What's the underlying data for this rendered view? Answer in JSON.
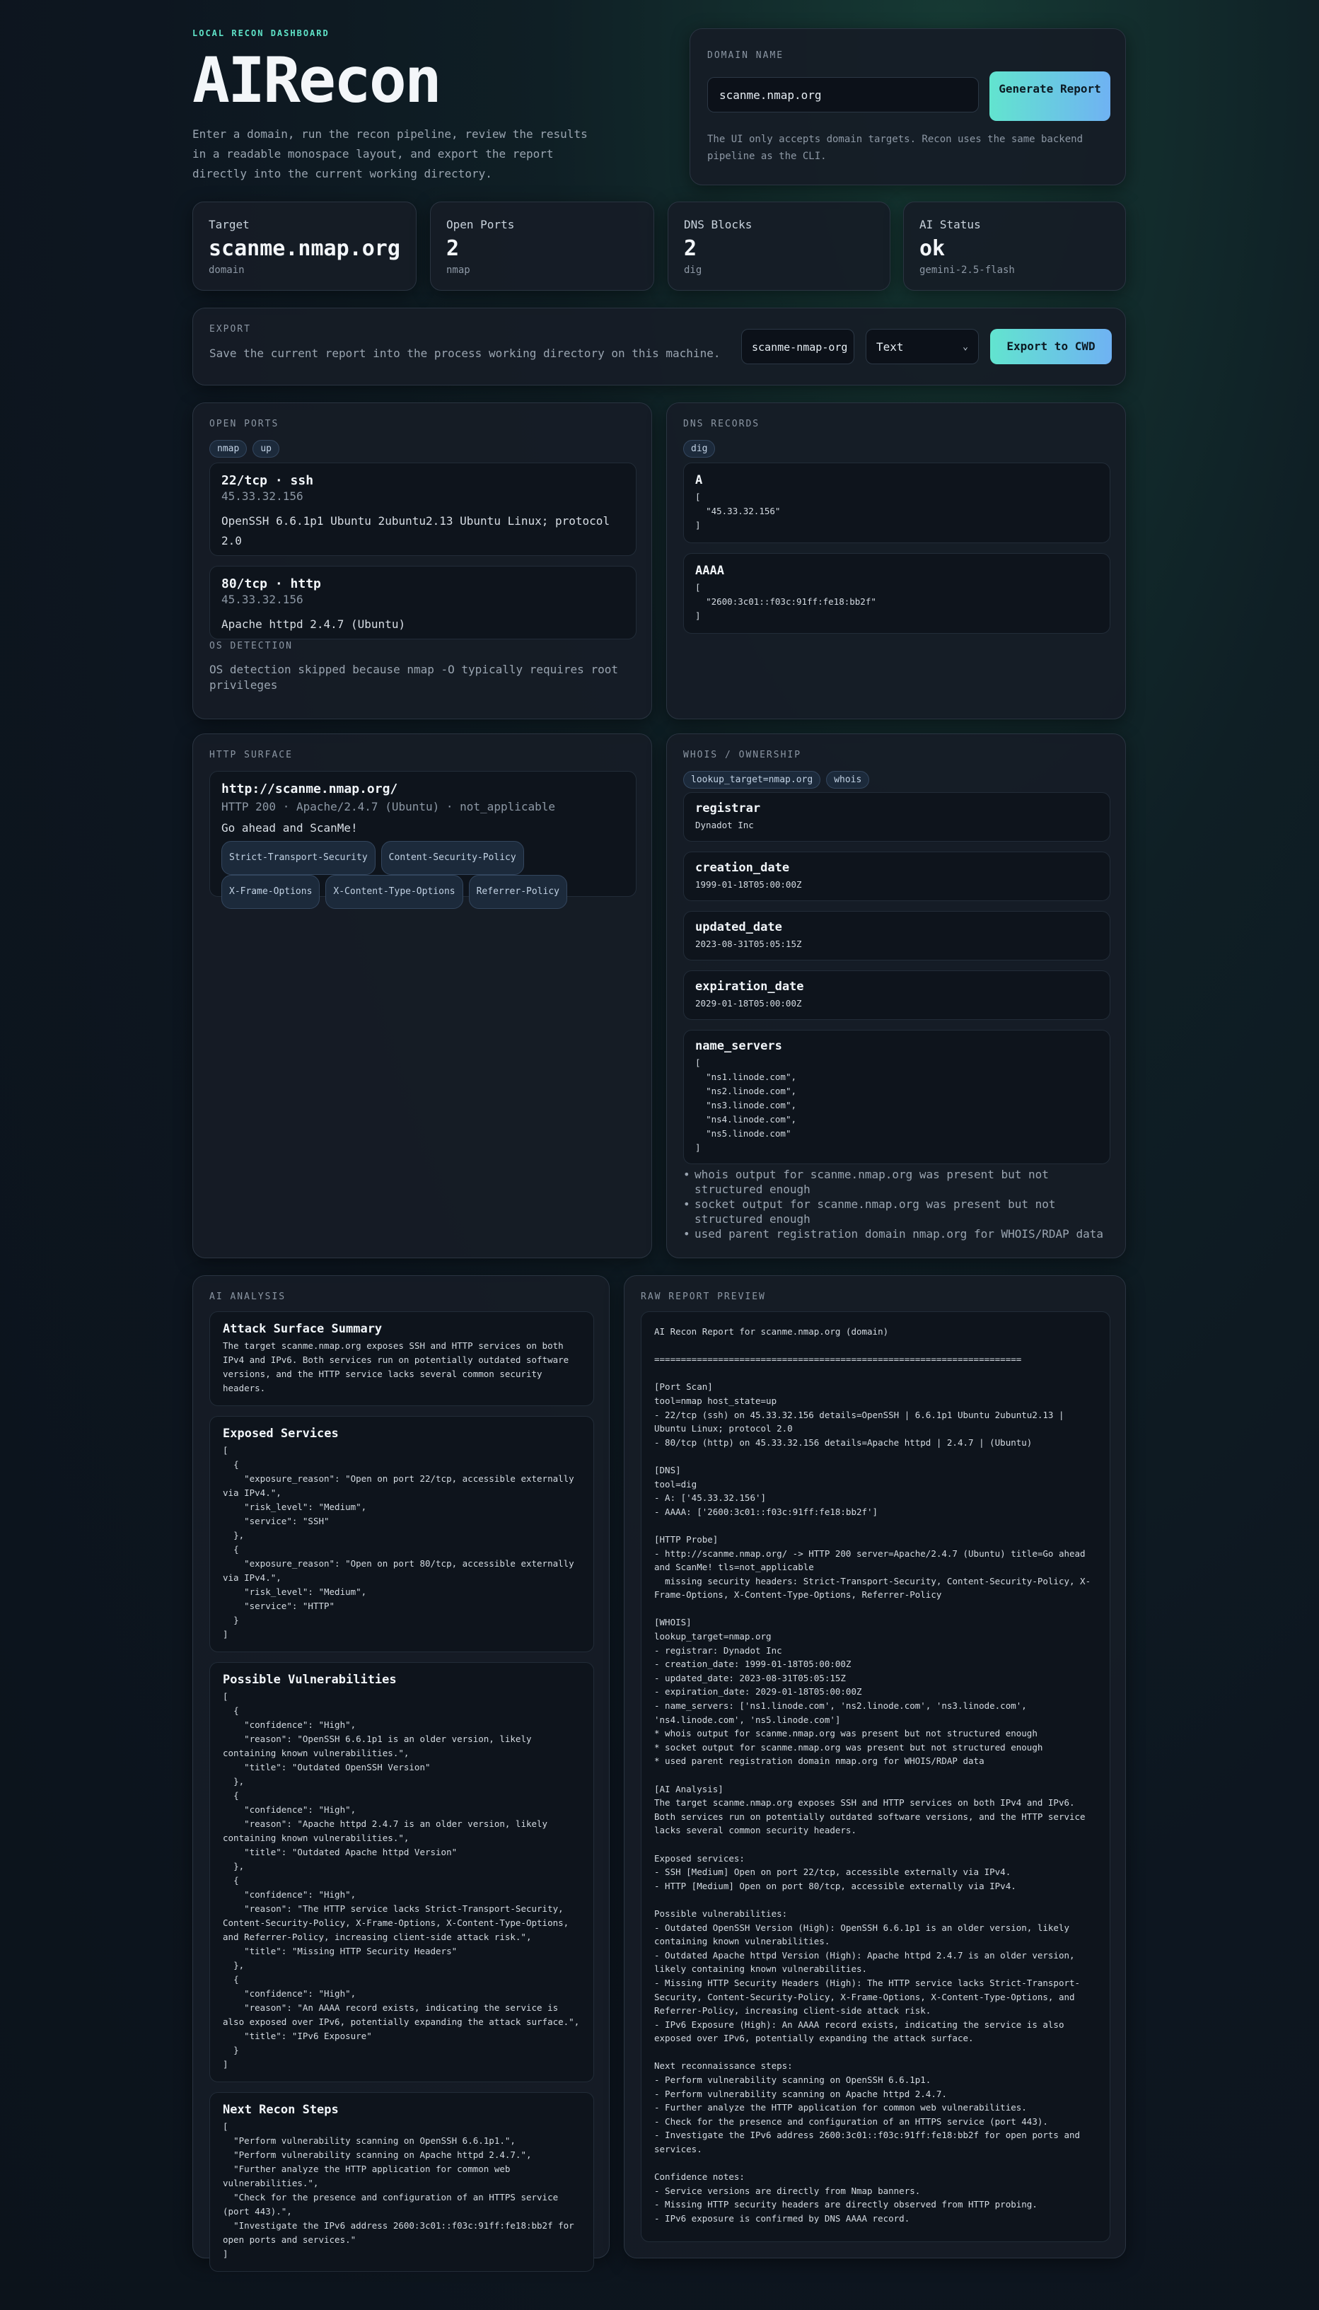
{
  "header": {
    "kicker": "LOCAL RECON DASHBOARD",
    "title": "AIRecon",
    "description": "Enter a domain, run the recon pipeline, review the results in a readable monospace layout, and export the report directly into the current working directory."
  },
  "domain_form": {
    "label": "DOMAIN NAME",
    "value": "scanme.nmap.org",
    "button": "Generate Report",
    "hint": "The UI only accepts domain targets. Recon uses the same backend pipeline as the CLI."
  },
  "stats": [
    {
      "label": "Target",
      "value": "scanme.nmap.org",
      "sub": "domain"
    },
    {
      "label": "Open Ports",
      "value": "2",
      "sub": "nmap"
    },
    {
      "label": "DNS Blocks",
      "value": "2",
      "sub": "dig"
    },
    {
      "label": "AI Status",
      "value": "ok",
      "sub": "gemini-2.5-flash"
    }
  ],
  "export": {
    "label": "EXPORT",
    "description": "Save the current report into the process working directory on this machine.",
    "filename": "scanme-nmap-org",
    "format": "Text",
    "button": "Export to CWD"
  },
  "open_ports": {
    "label": "OPEN PORTS",
    "chips": [
      "nmap",
      "up"
    ],
    "ports": [
      {
        "title": "22/tcp · ssh",
        "ip": "45.33.32.156",
        "detail": "OpenSSH 6.6.1p1 Ubuntu 2ubuntu2.13 Ubuntu Linux; protocol 2.0"
      },
      {
        "title": "80/tcp · http",
        "ip": "45.33.32.156",
        "detail": "Apache httpd 2.4.7 (Ubuntu)"
      }
    ],
    "os_label": "OS DETECTION",
    "os_text": "OS detection skipped because nmap -O typically requires root privileges"
  },
  "dns_records": {
    "label": "DNS RECORDS",
    "chips": [
      "dig"
    ],
    "records": [
      {
        "type": "A",
        "body": "[\n  \"45.33.32.156\"\n]"
      },
      {
        "type": "AAAA",
        "body": "[\n  \"2600:3c01::f03c:91ff:fe18:bb2f\"\n]"
      }
    ]
  },
  "http_surface": {
    "label": "HTTP SURFACE",
    "url": "http://scanme.nmap.org/",
    "meta": "HTTP 200 · Apache/2.4.7 (Ubuntu) · not_applicable",
    "title_text": "Go ahead and ScanMe!",
    "headers": [
      "Strict-Transport-Security",
      "Content-Security-Policy",
      "X-Frame-Options",
      "X-Content-Type-Options",
      "Referrer-Policy"
    ]
  },
  "whois": {
    "label": "WHOIS / OWNERSHIP",
    "chips": [
      "lookup_target=nmap.org",
      "whois"
    ],
    "fields": [
      {
        "key": "registrar",
        "value": "Dynadot Inc"
      },
      {
        "key": "creation_date",
        "value": "1999-01-18T05:00:00Z"
      },
      {
        "key": "updated_date",
        "value": "2023-08-31T05:05:15Z"
      },
      {
        "key": "expiration_date",
        "value": "2029-01-18T05:00:00Z"
      },
      {
        "key": "name_servers",
        "value": "[\n  \"ns1.linode.com\",\n  \"ns2.linode.com\",\n  \"ns3.linode.com\",\n  \"ns4.linode.com\",\n  \"ns5.linode.com\"\n]"
      }
    ],
    "notes": [
      "whois output for scanme.nmap.org was present but not structured enough",
      "socket output for scanme.nmap.org was present but not structured enough",
      "used parent registration domain nmap.org for WHOIS/RDAP data"
    ]
  },
  "ai_analysis": {
    "label": "AI ANALYSIS",
    "sections": [
      {
        "title": "Attack Surface Summary",
        "body": "The target scanme.nmap.org exposes SSH and HTTP services on both IPv4 and IPv6. Both services run on potentially outdated software versions, and the HTTP service lacks several common security headers."
      },
      {
        "title": "Exposed Services",
        "body": "[\n  {\n    \"exposure_reason\": \"Open on port 22/tcp, accessible externally via IPv4.\",\n    \"risk_level\": \"Medium\",\n    \"service\": \"SSH\"\n  },\n  {\n    \"exposure_reason\": \"Open on port 80/tcp, accessible externally via IPv4.\",\n    \"risk_level\": \"Medium\",\n    \"service\": \"HTTP\"\n  }\n]"
      },
      {
        "title": "Possible Vulnerabilities",
        "body": "[\n  {\n    \"confidence\": \"High\",\n    \"reason\": \"OpenSSH 6.6.1p1 is an older version, likely containing known vulnerabilities.\",\n    \"title\": \"Outdated OpenSSH Version\"\n  },\n  {\n    \"confidence\": \"High\",\n    \"reason\": \"Apache httpd 2.4.7 is an older version, likely containing known vulnerabilities.\",\n    \"title\": \"Outdated Apache httpd Version\"\n  },\n  {\n    \"confidence\": \"High\",\n    \"reason\": \"The HTTP service lacks Strict-Transport-Security, Content-Security-Policy, X-Frame-Options, X-Content-Type-Options, and Referrer-Policy, increasing client-side attack risk.\",\n    \"title\": \"Missing HTTP Security Headers\"\n  },\n  {\n    \"confidence\": \"High\",\n    \"reason\": \"An AAAA record exists, indicating the service is also exposed over IPv6, potentially expanding the attack surface.\",\n    \"title\": \"IPv6 Exposure\"\n  }\n]"
      },
      {
        "title": "Next Recon Steps",
        "body": "[\n  \"Perform vulnerability scanning on OpenSSH 6.6.1p1.\",\n  \"Perform vulnerability scanning on Apache httpd 2.4.7.\",\n  \"Further analyze the HTTP application for common web vulnerabilities.\",\n  \"Check for the presence and configuration of an HTTPS service (port 443).\",\n  \"Investigate the IPv6 address 2600:3c01::f03c:91ff:fe18:bb2f for open ports and services.\"\n]"
      }
    ]
  },
  "raw_report": {
    "label": "RAW REPORT PREVIEW",
    "text": "AI Recon Report for scanme.nmap.org (domain)\n\n=====================================================================\n\n[Port Scan]\ntool=nmap host_state=up\n- 22/tcp (ssh) on 45.33.32.156 details=OpenSSH | 6.6.1p1 Ubuntu 2ubuntu2.13 | Ubuntu Linux; protocol 2.0\n- 80/tcp (http) on 45.33.32.156 details=Apache httpd | 2.4.7 | (Ubuntu)\n\n[DNS]\ntool=dig\n- A: ['45.33.32.156']\n- AAAA: ['2600:3c01::f03c:91ff:fe18:bb2f']\n\n[HTTP Probe]\n- http://scanme.nmap.org/ -> HTTP 200 server=Apache/2.4.7 (Ubuntu) title=Go ahead and ScanMe! tls=not_applicable\n  missing security headers: Strict-Transport-Security, Content-Security-Policy, X-Frame-Options, X-Content-Type-Options, Referrer-Policy\n\n[WHOIS]\nlookup_target=nmap.org\n- registrar: Dynadot Inc\n- creation_date: 1999-01-18T05:00:00Z\n- updated_date: 2023-08-31T05:05:15Z\n- expiration_date: 2029-01-18T05:00:00Z\n- name_servers: ['ns1.linode.com', 'ns2.linode.com', 'ns3.linode.com', 'ns4.linode.com', 'ns5.linode.com']\n* whois output for scanme.nmap.org was present but not structured enough\n* socket output for scanme.nmap.org was present but not structured enough\n* used parent registration domain nmap.org for WHOIS/RDAP data\n\n[AI Analysis]\nThe target scanme.nmap.org exposes SSH and HTTP services on both IPv4 and IPv6. Both services run on potentially outdated software versions, and the HTTP service lacks several common security headers.\n\nExposed services:\n- SSH [Medium] Open on port 22/tcp, accessible externally via IPv4.\n- HTTP [Medium] Open on port 80/tcp, accessible externally via IPv4.\n\nPossible vulnerabilities:\n- Outdated OpenSSH Version (High): OpenSSH 6.6.1p1 is an older version, likely containing known vulnerabilities.\n- Outdated Apache httpd Version (High): Apache httpd 2.4.7 is an older version, likely containing known vulnerabilities.\n- Missing HTTP Security Headers (High): The HTTP service lacks Strict-Transport-Security, Content-Security-Policy, X-Frame-Options, X-Content-Type-Options, and Referrer-Policy, increasing client-side attack risk.\n- IPv6 Exposure (High): An AAAA record exists, indicating the service is also exposed over IPv6, potentially expanding the attack surface.\n\nNext reconnaissance steps:\n- Perform vulnerability scanning on OpenSSH 6.6.1p1.\n- Perform vulnerability scanning on Apache httpd 2.4.7.\n- Further analyze the HTTP application for common web vulnerabilities.\n- Check for the presence and configuration of an HTTPS service (port 443).\n- Investigate the IPv6 address 2600:3c01::f03c:91ff:fe18:bb2f for open ports and services.\n\nConfidence notes:\n- Service versions are directly from Nmap banners.\n- Missing HTTP security headers are directly observed from HTTP probing.\n- IPv6 exposure is confirmed by DNS AAAA record."
  },
  "colors": {
    "accent": "#5fe3c8",
    "accent2": "#6fb2f3",
    "bg": "#0d1620",
    "panel": "#161c26"
  },
  "icons": {
    "select_chevron": "chevron-down-icon",
    "note_bullet": "bullet-icon"
  }
}
